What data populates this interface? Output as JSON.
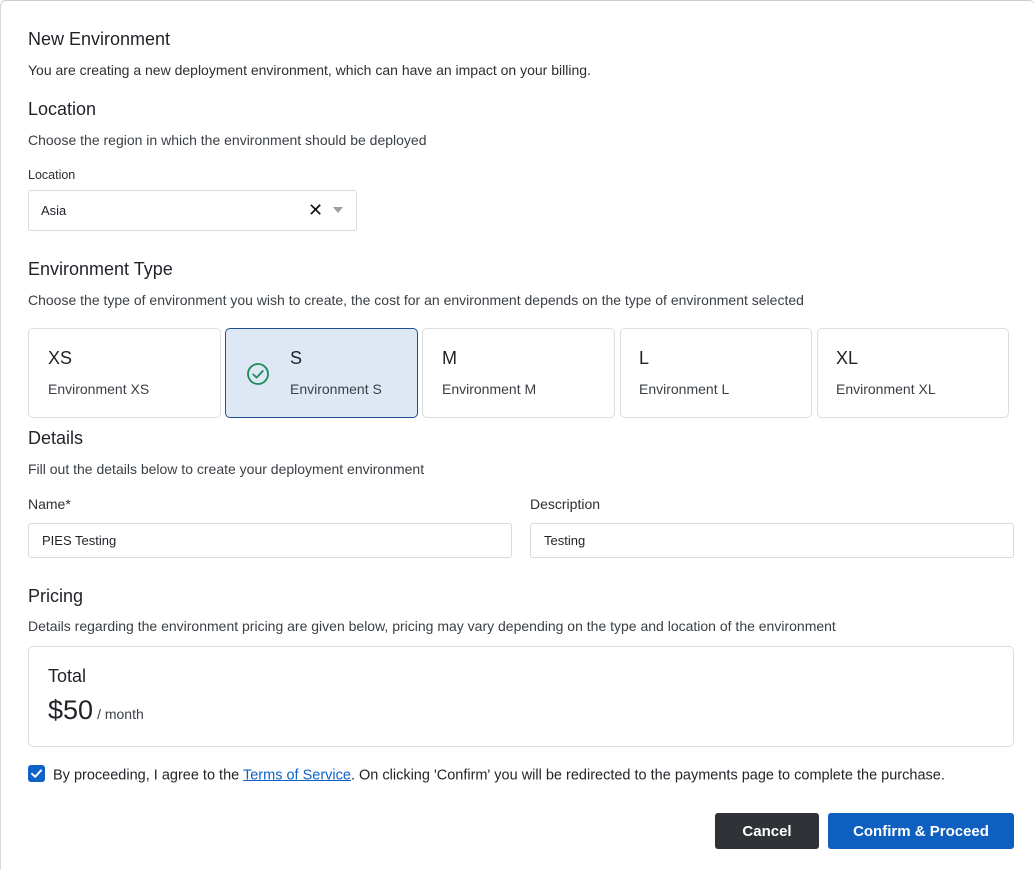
{
  "dialog": {
    "title": "New Environment",
    "subtitle": "You are creating a new deployment environment, which can have an impact on your billing."
  },
  "location": {
    "title": "Location",
    "description": "Choose the region in which the environment should be deployed",
    "field_label": "Location",
    "selected_value": "Asia",
    "clear_glyph": "✕"
  },
  "environment_type": {
    "title": "Environment Type",
    "description": "Choose the type of environment you wish to create, the cost for an environment depends on the type of environment selected",
    "options": [
      {
        "code": "XS",
        "name": "Environment XS",
        "selected": false
      },
      {
        "code": "S",
        "name": "Environment S",
        "selected": true
      },
      {
        "code": "M",
        "name": "Environment M",
        "selected": false
      },
      {
        "code": "L",
        "name": "Environment L",
        "selected": false
      },
      {
        "code": "XL",
        "name": "Environment XL",
        "selected": false
      }
    ]
  },
  "details": {
    "title": "Details",
    "description": "Fill out the details below to create your deployment environment",
    "name_label": "Name*",
    "name_value": "PIES Testing",
    "description_label": "Description",
    "description_value": "Testing"
  },
  "pricing": {
    "title": "Pricing",
    "description": "Details regarding the environment pricing are given below, pricing may vary depending on the type and location of the environment",
    "total_label": "Total",
    "total_amount": "$50",
    "total_unit": "/ month"
  },
  "agreement": {
    "checked": true,
    "text_before": "By proceeding, I agree to the ",
    "link_text": "Terms of Service",
    "text_after": ". On clicking 'Confirm' you will be redirected to the payments page to complete the purchase."
  },
  "buttons": {
    "cancel_label": "Cancel",
    "confirm_label": "Confirm & Proceed"
  },
  "colors": {
    "primary": "#0f5fc0",
    "selected_card_bg": "#dde8f4",
    "selected_card_border": "#1f4f8f",
    "check_icon": "#1e8a5a",
    "cancel_bg": "#2f3237"
  },
  "icons": {
    "selected_card": "check-circle-icon",
    "clear": "close-icon",
    "dropdown": "caret-down-icon",
    "checkbox": "checkmark-icon"
  }
}
